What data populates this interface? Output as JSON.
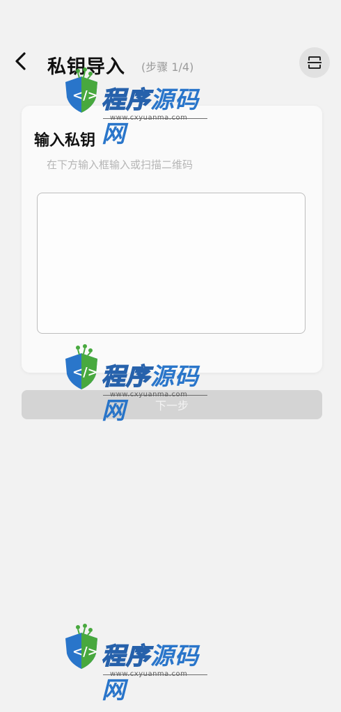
{
  "header": {
    "title": "私钥导入",
    "step": "(步骤 1/4)"
  },
  "card": {
    "title": "输入私钥",
    "hint": "在下方输入框输入或扫描二维码",
    "input_value": "",
    "input_placeholder": ""
  },
  "next_button": {
    "label": "下一步"
  },
  "watermark": {
    "text_a": "程序",
    "text_b": "源码网",
    "url": "www.cxyuanma.com"
  },
  "colors": {
    "background": "#f2f2f2",
    "card": "#fafafa",
    "button_disabled": "#d4d4d4",
    "hint_text": "#b5b5b5",
    "watermark_blue": "#1f6fc8",
    "watermark_green": "#3fa535"
  },
  "icons": {
    "back": "chevron-left-icon",
    "scan": "scan-icon"
  }
}
